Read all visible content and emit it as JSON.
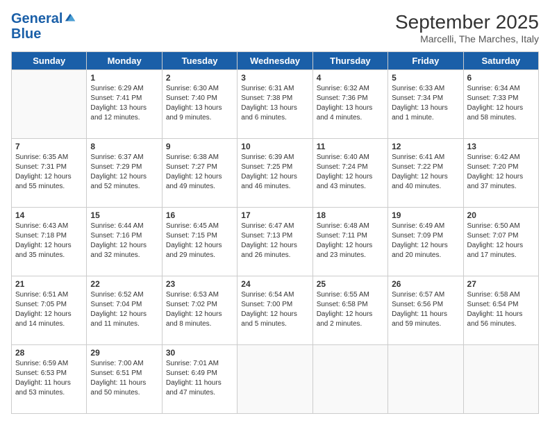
{
  "header": {
    "logo_line1": "General",
    "logo_line2": "Blue",
    "month_title": "September 2025",
    "location": "Marcelli, The Marches, Italy"
  },
  "days_of_week": [
    "Sunday",
    "Monday",
    "Tuesday",
    "Wednesday",
    "Thursday",
    "Friday",
    "Saturday"
  ],
  "weeks": [
    [
      {
        "day": "",
        "info": ""
      },
      {
        "day": "1",
        "info": "Sunrise: 6:29 AM\nSunset: 7:41 PM\nDaylight: 13 hours\nand 12 minutes."
      },
      {
        "day": "2",
        "info": "Sunrise: 6:30 AM\nSunset: 7:40 PM\nDaylight: 13 hours\nand 9 minutes."
      },
      {
        "day": "3",
        "info": "Sunrise: 6:31 AM\nSunset: 7:38 PM\nDaylight: 13 hours\nand 6 minutes."
      },
      {
        "day": "4",
        "info": "Sunrise: 6:32 AM\nSunset: 7:36 PM\nDaylight: 13 hours\nand 4 minutes."
      },
      {
        "day": "5",
        "info": "Sunrise: 6:33 AM\nSunset: 7:34 PM\nDaylight: 13 hours\nand 1 minute."
      },
      {
        "day": "6",
        "info": "Sunrise: 6:34 AM\nSunset: 7:33 PM\nDaylight: 12 hours\nand 58 minutes."
      }
    ],
    [
      {
        "day": "7",
        "info": "Sunrise: 6:35 AM\nSunset: 7:31 PM\nDaylight: 12 hours\nand 55 minutes."
      },
      {
        "day": "8",
        "info": "Sunrise: 6:37 AM\nSunset: 7:29 PM\nDaylight: 12 hours\nand 52 minutes."
      },
      {
        "day": "9",
        "info": "Sunrise: 6:38 AM\nSunset: 7:27 PM\nDaylight: 12 hours\nand 49 minutes."
      },
      {
        "day": "10",
        "info": "Sunrise: 6:39 AM\nSunset: 7:25 PM\nDaylight: 12 hours\nand 46 minutes."
      },
      {
        "day": "11",
        "info": "Sunrise: 6:40 AM\nSunset: 7:24 PM\nDaylight: 12 hours\nand 43 minutes."
      },
      {
        "day": "12",
        "info": "Sunrise: 6:41 AM\nSunset: 7:22 PM\nDaylight: 12 hours\nand 40 minutes."
      },
      {
        "day": "13",
        "info": "Sunrise: 6:42 AM\nSunset: 7:20 PM\nDaylight: 12 hours\nand 37 minutes."
      }
    ],
    [
      {
        "day": "14",
        "info": "Sunrise: 6:43 AM\nSunset: 7:18 PM\nDaylight: 12 hours\nand 35 minutes."
      },
      {
        "day": "15",
        "info": "Sunrise: 6:44 AM\nSunset: 7:16 PM\nDaylight: 12 hours\nand 32 minutes."
      },
      {
        "day": "16",
        "info": "Sunrise: 6:45 AM\nSunset: 7:15 PM\nDaylight: 12 hours\nand 29 minutes."
      },
      {
        "day": "17",
        "info": "Sunrise: 6:47 AM\nSunset: 7:13 PM\nDaylight: 12 hours\nand 26 minutes."
      },
      {
        "day": "18",
        "info": "Sunrise: 6:48 AM\nSunset: 7:11 PM\nDaylight: 12 hours\nand 23 minutes."
      },
      {
        "day": "19",
        "info": "Sunrise: 6:49 AM\nSunset: 7:09 PM\nDaylight: 12 hours\nand 20 minutes."
      },
      {
        "day": "20",
        "info": "Sunrise: 6:50 AM\nSunset: 7:07 PM\nDaylight: 12 hours\nand 17 minutes."
      }
    ],
    [
      {
        "day": "21",
        "info": "Sunrise: 6:51 AM\nSunset: 7:05 PM\nDaylight: 12 hours\nand 14 minutes."
      },
      {
        "day": "22",
        "info": "Sunrise: 6:52 AM\nSunset: 7:04 PM\nDaylight: 12 hours\nand 11 minutes."
      },
      {
        "day": "23",
        "info": "Sunrise: 6:53 AM\nSunset: 7:02 PM\nDaylight: 12 hours\nand 8 minutes."
      },
      {
        "day": "24",
        "info": "Sunrise: 6:54 AM\nSunset: 7:00 PM\nDaylight: 12 hours\nand 5 minutes."
      },
      {
        "day": "25",
        "info": "Sunrise: 6:55 AM\nSunset: 6:58 PM\nDaylight: 12 hours\nand 2 minutes."
      },
      {
        "day": "26",
        "info": "Sunrise: 6:57 AM\nSunset: 6:56 PM\nDaylight: 11 hours\nand 59 minutes."
      },
      {
        "day": "27",
        "info": "Sunrise: 6:58 AM\nSunset: 6:54 PM\nDaylight: 11 hours\nand 56 minutes."
      }
    ],
    [
      {
        "day": "28",
        "info": "Sunrise: 6:59 AM\nSunset: 6:53 PM\nDaylight: 11 hours\nand 53 minutes."
      },
      {
        "day": "29",
        "info": "Sunrise: 7:00 AM\nSunset: 6:51 PM\nDaylight: 11 hours\nand 50 minutes."
      },
      {
        "day": "30",
        "info": "Sunrise: 7:01 AM\nSunset: 6:49 PM\nDaylight: 11 hours\nand 47 minutes."
      },
      {
        "day": "",
        "info": ""
      },
      {
        "day": "",
        "info": ""
      },
      {
        "day": "",
        "info": ""
      },
      {
        "day": "",
        "info": ""
      }
    ]
  ]
}
